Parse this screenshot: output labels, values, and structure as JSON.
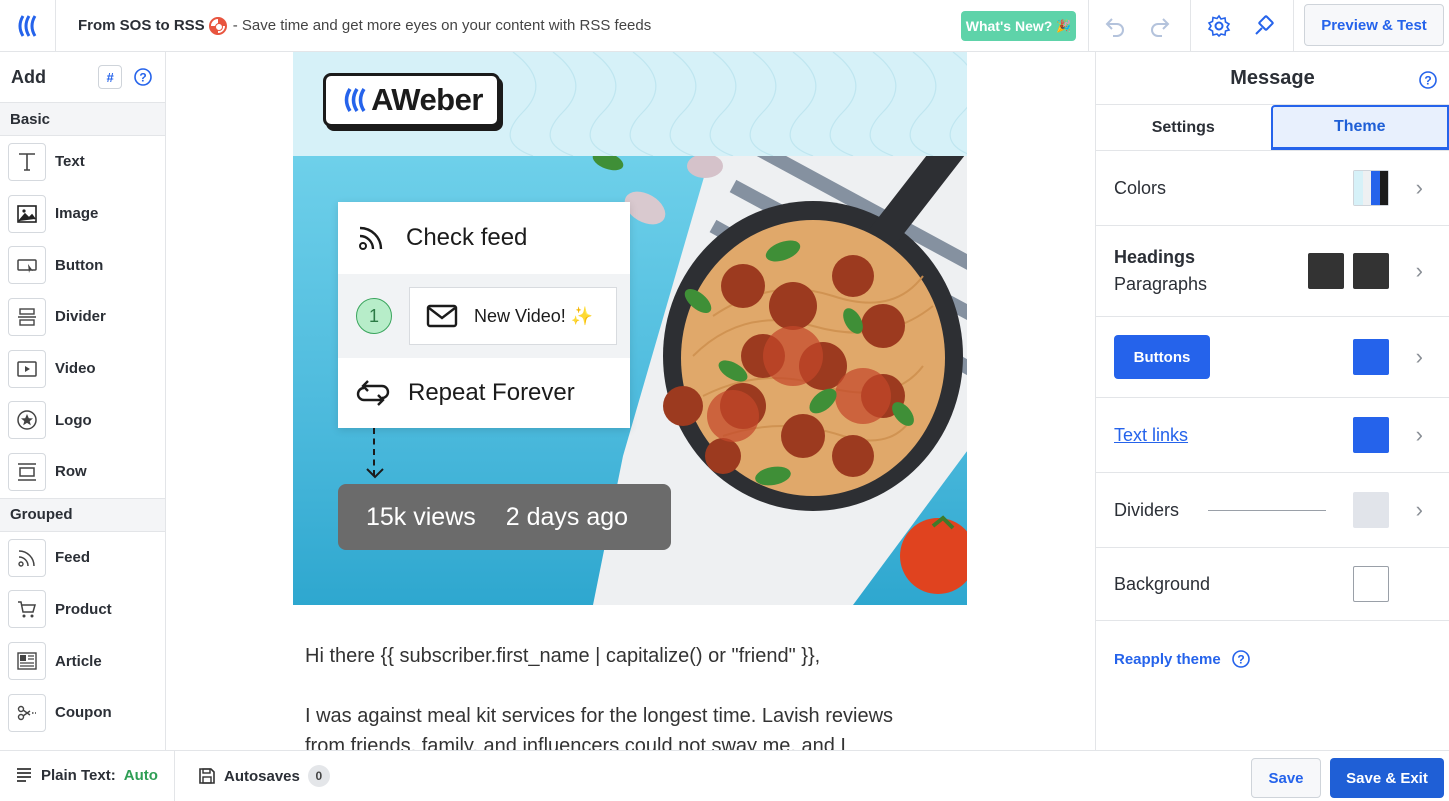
{
  "topbar": {
    "title_bold": "From SOS to RSS",
    "title_sub": "- Save time and get more eyes on your content with RSS feeds",
    "whats_new": "What's New?",
    "preview_test": "Preview & Test"
  },
  "sidebar": {
    "heading": "Add",
    "hash_label": "#",
    "basic_label": "Basic",
    "basic_items": [
      {
        "label": "Text"
      },
      {
        "label": "Image"
      },
      {
        "label": "Button"
      },
      {
        "label": "Divider"
      },
      {
        "label": "Video"
      },
      {
        "label": "Logo"
      },
      {
        "label": "Row"
      }
    ],
    "grouped_label": "Grouped",
    "grouped_items": [
      {
        "label": "Feed"
      },
      {
        "label": "Product"
      },
      {
        "label": "Article"
      },
      {
        "label": "Coupon"
      }
    ]
  },
  "canvas": {
    "logo_text": "AWeber",
    "flow": {
      "check_feed": "Check feed",
      "step_number": "1",
      "new_video": "New Video!",
      "repeat": "Repeat Forever"
    },
    "stats": {
      "views": "15k views",
      "age": "2 days ago"
    },
    "greeting": "Hi there {{ subscriber.first_name | capitalize() or \"friend\" }},",
    "paragraph_line1": "I was against meal kit services for the longest time. Lavish reviews",
    "paragraph_line2": "from friends, family, and influencers could not sway me, and I"
  },
  "panel": {
    "title": "Message",
    "tabs": [
      {
        "label": "Settings"
      },
      {
        "label": "Theme"
      }
    ],
    "active_tab": "Theme",
    "rows": {
      "colors": "Colors",
      "headings": "Headings",
      "paragraphs": "Paragraphs",
      "buttons": "Buttons",
      "text_links": "Text links",
      "dividers": "Dividers",
      "background": "Background"
    },
    "reapply": "Reapply theme",
    "colors": {
      "heading_swatch": "#333333",
      "paragraph_swatch": "#333333",
      "button_swatch": "#2563eb",
      "link_swatch": "#2563eb",
      "divider_swatch": "#e1e4ea",
      "background_swatch": "#ffffff"
    }
  },
  "bottombar": {
    "plain_text_label": "Plain Text:",
    "plain_text_value": "Auto",
    "autosaves_label": "Autosaves",
    "autosaves_count": "0",
    "save": "Save",
    "save_exit": "Save & Exit"
  }
}
